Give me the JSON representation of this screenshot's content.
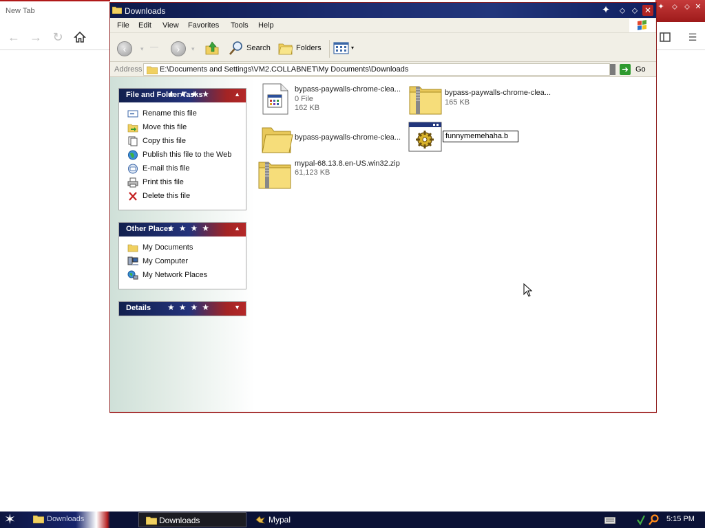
{
  "browser": {
    "tab_title": "New Tab"
  },
  "explorer": {
    "title": "Downloads",
    "menu": [
      "File",
      "Edit",
      "View",
      "Favorites",
      "Tools",
      "Help"
    ],
    "toolbar": {
      "search_label": "Search",
      "folders_label": "Folders"
    },
    "address": {
      "label": "Address",
      "path": "E:\\Documents and Settings\\VM2.COLLABNET\\My Documents\\Downloads",
      "go_label": "Go"
    },
    "tasks_panel": {
      "title": "File and Folder Tasks",
      "items": [
        {
          "label": "Rename this file",
          "icon": "rename-icon"
        },
        {
          "label": "Move this file",
          "icon": "move-icon"
        },
        {
          "label": "Copy this file",
          "icon": "copy-icon"
        },
        {
          "label": "Publish this file to the Web",
          "icon": "globe-icon"
        },
        {
          "label": "E-mail this file",
          "icon": "email-icon"
        },
        {
          "label": "Print this file",
          "icon": "print-icon"
        },
        {
          "label": "Delete this file",
          "icon": "delete-icon"
        }
      ]
    },
    "places_panel": {
      "title": "Other Places",
      "items": [
        {
          "label": "My Documents",
          "icon": "folder-icon"
        },
        {
          "label": "My Computer",
          "icon": "computer-icon"
        },
        {
          "label": "My Network Places",
          "icon": "network-icon"
        }
      ]
    },
    "details_panel": {
      "title": "Details"
    },
    "files": [
      {
        "name": "bypass-paywalls-chrome-clea...",
        "type": "0 File",
        "size": "162 KB",
        "icon": "file-icon"
      },
      {
        "name": "bypass-paywalls-chrome-clea...",
        "size": "165 KB",
        "icon": "zip-folder-icon"
      },
      {
        "name": "bypass-paywalls-chrome-clea...",
        "icon": "folder-icon"
      },
      {
        "name": "",
        "icon": "application-icon",
        "rename_value": "funnymemehaha.b"
      },
      {
        "name": "mypal-68.13.8.en-US.win32.zip",
        "size": "61,123 KB",
        "icon": "zip-folder-icon"
      }
    ]
  },
  "taskbar": {
    "start_item": "Downloads",
    "tasks": [
      {
        "label": "Downloads",
        "active": true
      },
      {
        "label": "Mypal",
        "active": false
      }
    ],
    "clock": "5:15 PM"
  },
  "colors": {
    "title_navy": "#1b2b6e",
    "accent_red": "#b02424",
    "toolbar_bg": "#f1efe6",
    "taskbar_bg": "#0b1236"
  }
}
